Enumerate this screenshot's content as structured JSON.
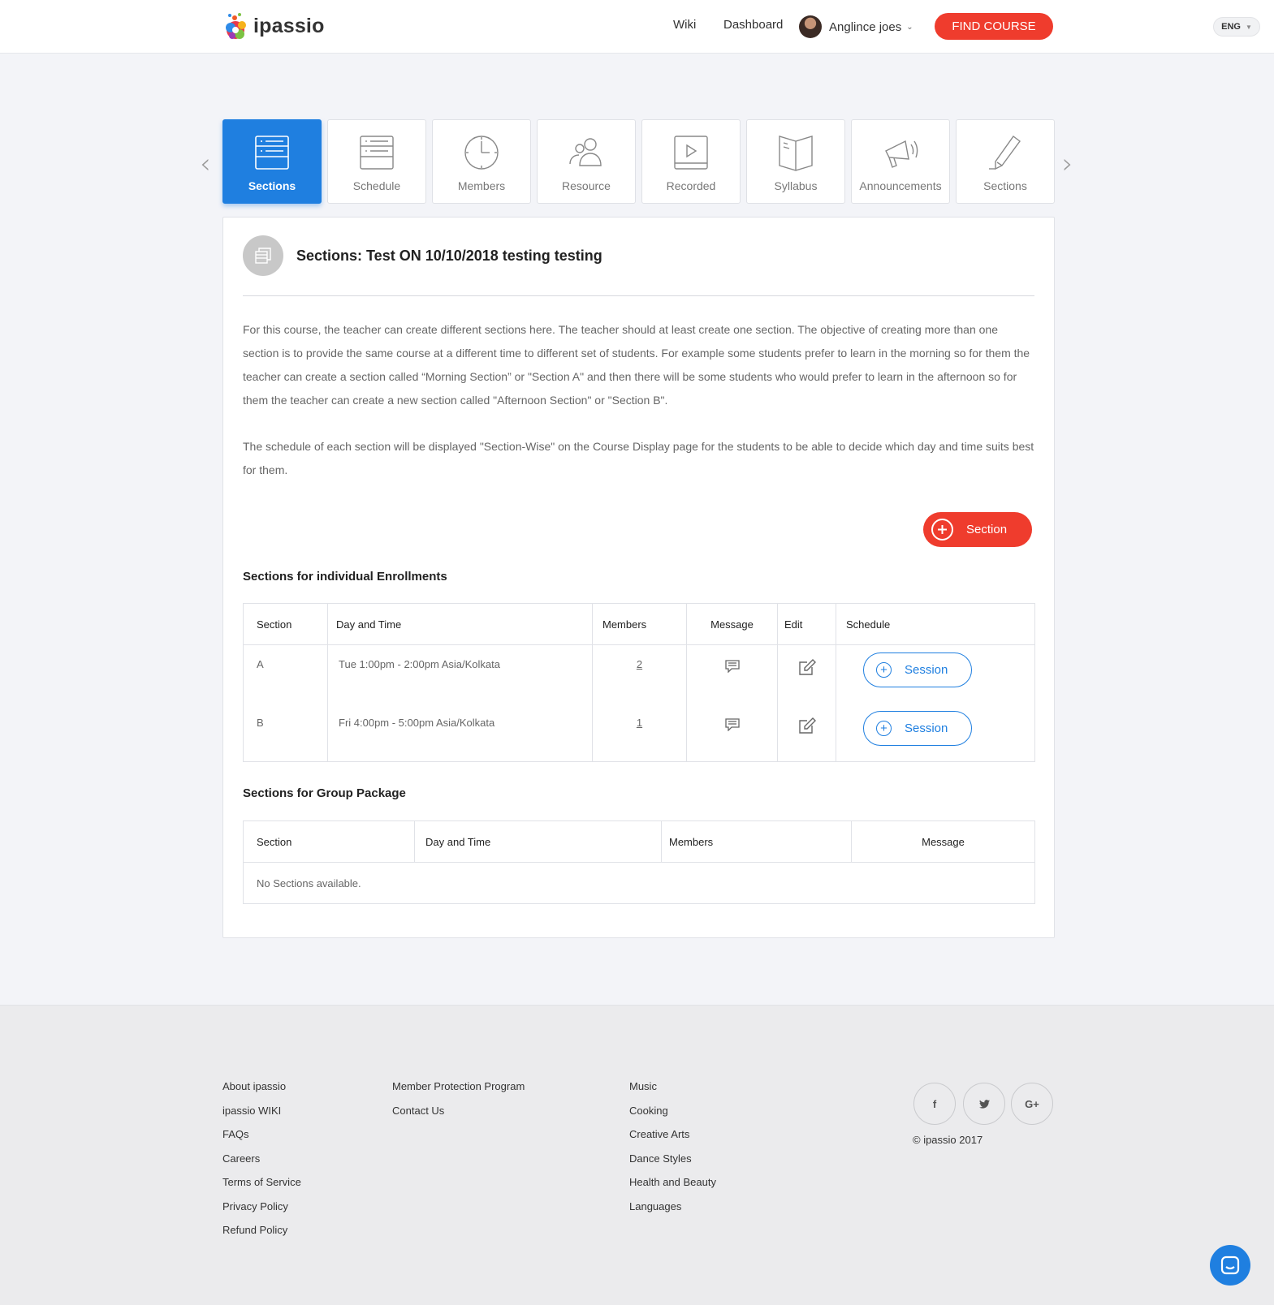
{
  "header": {
    "logo_text": "ipassio",
    "nav": {
      "wiki": "Wiki",
      "dashboard": "Dashboard"
    },
    "user_name": "Anglince joes",
    "find_course": "FIND COURSE",
    "language": "ENG"
  },
  "tabs": [
    {
      "label": "Sections",
      "icon": "sections-icon",
      "active": true
    },
    {
      "label": "Schedule",
      "icon": "schedule-icon"
    },
    {
      "label": "Members",
      "icon": "clock-icon"
    },
    {
      "label": "Resource",
      "icon": "members-icon"
    },
    {
      "label": "Recorded",
      "icon": "video-icon"
    },
    {
      "label": "Syllabus",
      "icon": "book-icon"
    },
    {
      "label": "Announcements",
      "icon": "megaphone-icon"
    },
    {
      "label": "Sections",
      "icon": "pencil-icon"
    }
  ],
  "panel": {
    "title": "Sections: Test ON 10/10/2018 testing testing",
    "desc1": "For this course, the teacher can create different sections here. The teacher should at least create one section. The objective of creating more than one section is to provide the same course at a different time to different set of students. For example some students prefer to learn in the morning so for them the teacher can create a section called “Morning Section” or \"Section A\" and then there will be some students who would prefer to learn in the afternoon so for them the teacher can create a new section called \"Afternoon Section\" or \"Section B\".",
    "desc2": "The schedule of each section will be displayed \"Section-Wise\" on the Course Display page for the students to be able to decide which day and time suits best for them.",
    "add_section": "Section",
    "individual_title": "Sections for individual Enrollments",
    "individual_headers": [
      "Section",
      "Day and Time",
      "Members",
      "Message",
      "Edit",
      "Schedule"
    ],
    "individual_rows": [
      {
        "section": "A",
        "time": "Tue 1:00pm - 2:00pm Asia/Kolkata",
        "members": "2",
        "session": "Session"
      },
      {
        "section": "B",
        "time": "Fri 4:00pm - 5:00pm Asia/Kolkata",
        "members": "1",
        "session": "Session"
      }
    ],
    "group_title": "Sections for Group Package",
    "group_headers": [
      "Section",
      "Day and Time",
      "Members",
      "Message"
    ],
    "group_empty": "No Sections available."
  },
  "footer": {
    "col1": [
      "About ipassio",
      "ipassio WIKI",
      "FAQs",
      "Careers",
      "Terms of Service",
      "Privacy Policy",
      "Refund Policy"
    ],
    "col2": [
      "Member Protection Program",
      "Contact Us"
    ],
    "col3": [
      "Music",
      "Cooking",
      "Creative Arts",
      "Dance Styles",
      "Health and Beauty",
      "Languages"
    ],
    "social": {
      "facebook": "f",
      "twitter": "t",
      "google": "G+"
    },
    "copyright": "© ipassio 2017"
  },
  "colors": {
    "primary_blue": "#1f7fe0",
    "accent_red": "#ef3c2d"
  }
}
